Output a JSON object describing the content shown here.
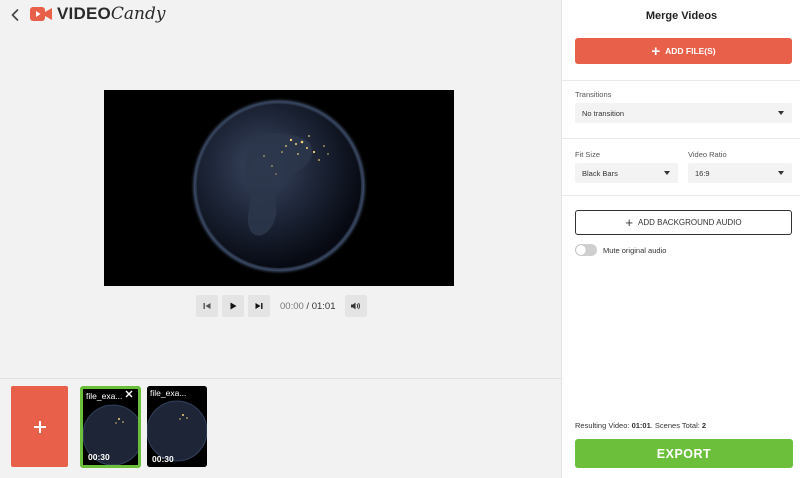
{
  "app": {
    "logo_text_bold": "VIDEO",
    "logo_text_script": "Candy",
    "brand_color": "#e8604a"
  },
  "player": {
    "time_current": "00:00",
    "time_separator": " / ",
    "time_total": "01:01"
  },
  "timeline": {
    "clips": [
      {
        "name": "file_exa...",
        "duration": "00:30",
        "selected": true
      },
      {
        "name": "file_exa...",
        "duration": "00:30",
        "selected": false
      }
    ]
  },
  "panel": {
    "title": "Merge Videos",
    "add_files_label": "ADD FILE(S)",
    "transitions_label": "Transitions",
    "transitions_value": "No transition",
    "fit_size_label": "Fit Size",
    "fit_size_value": "Black Bars",
    "video_ratio_label": "Video Ratio",
    "video_ratio_value": "16:9",
    "add_audio_label": "ADD BACKGROUND AUDIO",
    "mute_label": "Mute original audio",
    "mute_on": false,
    "summary_prefix": "Resulting Video: ",
    "summary_duration": "01:01",
    "summary_middle": ". Scenes Total: ",
    "summary_scenes": "2",
    "export_label": "EXPORT",
    "export_color": "#6cbf3a"
  }
}
